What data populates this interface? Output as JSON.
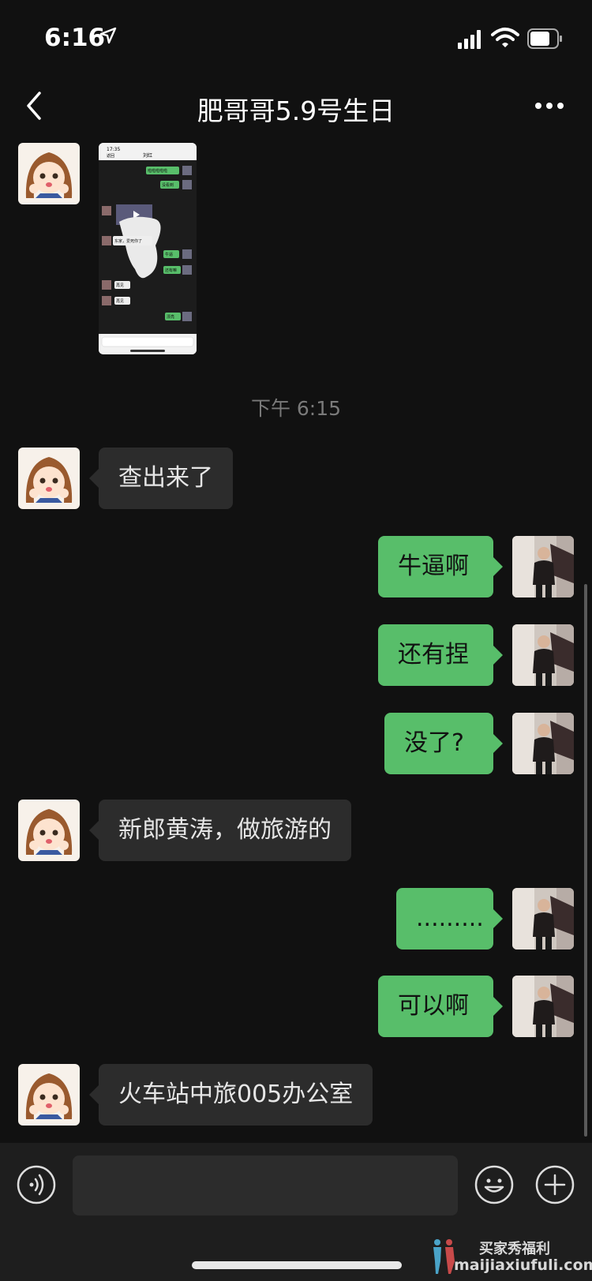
{
  "status_bar": {
    "time": "6:16"
  },
  "header": {
    "title": "肥哥哥5.9号生日"
  },
  "thumbnail": {
    "time": "17:35",
    "title": "刘红",
    "back": "返回",
    "messages": [
      "啦啦啦啦啦",
      "没看到",
      "东家，爱死你了",
      "牛逼",
      "还有嘛",
      "再见",
      "再见",
      "漂亮"
    ]
  },
  "timestamp": "下午 6:15",
  "messages": [
    {
      "side": "in",
      "text": "查出来了"
    },
    {
      "side": "out",
      "text": "牛逼啊"
    },
    {
      "side": "out",
      "text": "还有捏"
    },
    {
      "side": "out",
      "text": "没了?"
    },
    {
      "side": "in",
      "text": "新郎黄涛，做旅游的"
    },
    {
      "side": "out",
      "text": "........."
    },
    {
      "side": "out",
      "text": "可以啊"
    },
    {
      "side": "in",
      "text": "火车站中旅005办公室"
    }
  ],
  "input": {
    "value": ""
  },
  "watermark": {
    "line1": "买家秀福利",
    "line2": "maijiaxiufuli.com"
  },
  "colors": {
    "background": "#111111",
    "incoming_bubble": "#2c2c2c",
    "outgoing_bubble": "#58be6a"
  },
  "icons": [
    "location-arrow-icon",
    "signal-icon",
    "wifi-icon",
    "battery-icon",
    "back-chevron-icon",
    "more-dots-icon",
    "voice-icon",
    "emoji-icon",
    "plus-icon"
  ]
}
